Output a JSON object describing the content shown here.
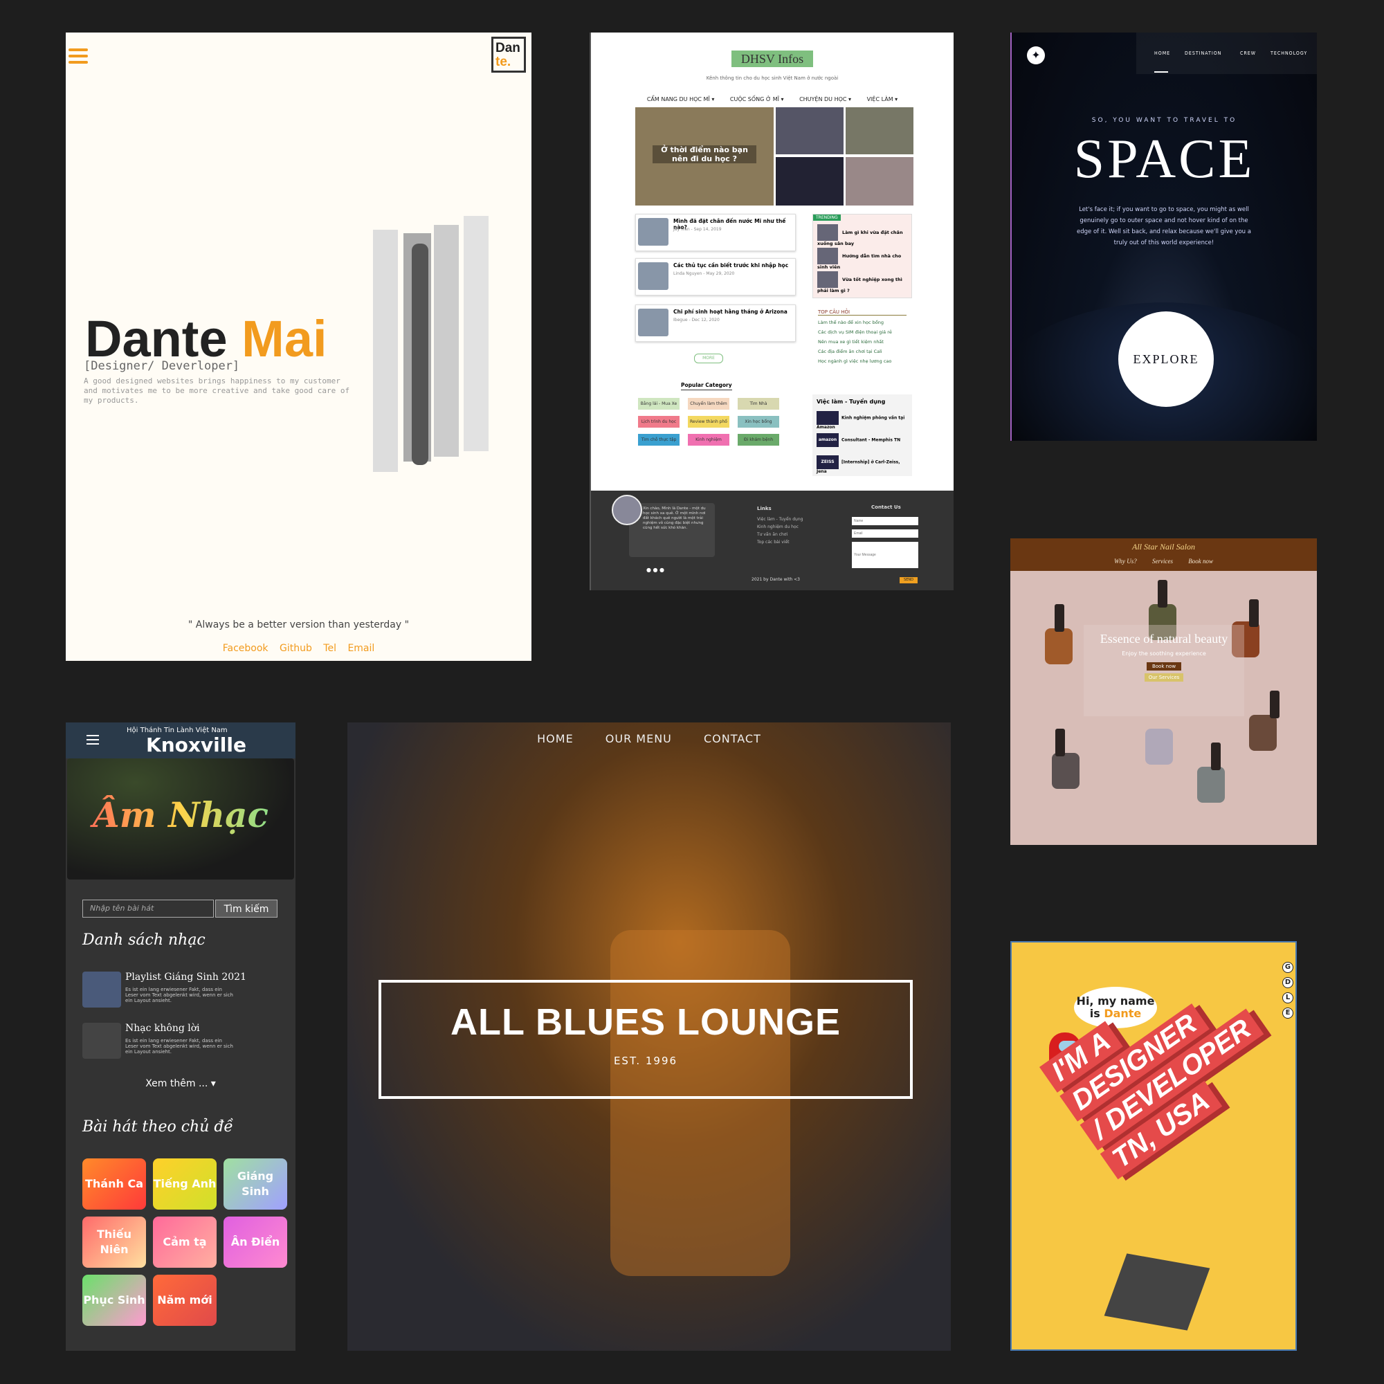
{
  "portfolio": {
    "logo_line1": "Dan",
    "logo_line2": "te.",
    "first_name": "Dante",
    "last_name": "Mai",
    "role": "[Designer/ Deverloper]",
    "description": "A good designed websites brings happiness to my customer and motivates me to be more creative and take good care of my products.",
    "quote": "\" Always be a better version than yesterday \"",
    "links": [
      "Facebook",
      "Github",
      "Tel",
      "Email"
    ]
  },
  "dhsv": {
    "title": "DHSV Infos",
    "tagline": "Kênh thông tin cho du học sinh Việt Nam ở nước ngoài",
    "nav": [
      "CẨM NANG DU HỌC MĨ ▾",
      "CUỘC SỐNG Ở MĨ ▾",
      "CHUYỆN DU HỌC ▾",
      "VIỆC LÀM ▾"
    ],
    "hero_title": "Ở thời điểm nào bạn nên đi du học ?",
    "posts": [
      {
        "title": "Mình đã đặt chân đến nước Mĩ như thế nào?",
        "meta": "Jay Tran - Sep 14, 2019"
      },
      {
        "title": "Các thủ tục cần biết trước khi nhập học",
        "meta": "Linda Nguyen - May 29, 2020"
      },
      {
        "title": "Chi phí sinh hoạt hằng tháng ở Arizona",
        "meta": "Ibegue - Dec 12, 2020"
      }
    ],
    "trending_label": "TRENDING",
    "trending": [
      "Làm gì khi vừa đặt chân xuống sân bay",
      "Hướng dẫn tìm nhà cho sinh viên",
      "Vừa tốt nghiệp xong thì phải làm gì ?"
    ],
    "more_label": "MORE",
    "faq_title": "TOP CÂU HỎI",
    "faq": [
      "Làm thế nào để xin học bổng",
      "Các dịch vụ SIM điện thoại giá rẻ",
      "Nên mua xe gì tiết kiệm nhất",
      "Các địa điểm ăn chơi tại Cali",
      "Học ngành gì việc nhẹ lương cao"
    ],
    "popular_category": "Popular Category",
    "categories": [
      "Bằng lái - Mua Xe",
      "Chuyến làm thêm",
      "Tìm Nhà",
      "Lịch trình du học",
      "Review thành phố",
      "Xin học bổng",
      "Tìm chỗ thực tập",
      "Kinh nghiệm",
      "Đi khám bệnh"
    ],
    "jobs_title": "Việc làm - Tuyển dụng",
    "jobs": [
      {
        "title": "Kinh nghiệm phỏng vấn tại Amazon",
        "logo": ""
      },
      {
        "title": "Consultant - Memphis TN",
        "logo": "amazon"
      },
      {
        "title": "[Internship] ở Carl-Zeiss, Jena",
        "logo": "ZEISS"
      }
    ],
    "footer": {
      "bio": "Xin chào, Mình là Dante - một du học sinh xa quê. Ở một mình nơi đất khách quê người là một trải nghiệm vô cùng đặc biệt nhưng cũng hết sức khó khăn.",
      "links_title": "Links",
      "links": [
        "Việc làm - Tuyển dụng",
        "Kinh nghiệm du học",
        "Tư vấn ăn chơi",
        "Top các bài viết"
      ],
      "contact_title": "Contact Us",
      "name_placeholder": "Name",
      "email_placeholder": "Email",
      "message_placeholder": "Your Message",
      "send_label": "SEND",
      "copyright": "2021 by Dante with <3"
    }
  },
  "space": {
    "nav": [
      "HOME",
      "DESTINATION",
      "CREW",
      "TECHNOLOGY"
    ],
    "subtitle": "SO, YOU WANT TO TRAVEL TO",
    "title": "SPACE",
    "paragraph": "Let's face it; if you want to go to space, you might as well genuinely go to outer space and not hover kind of on the edge of it. Well sit back, and relax because we'll give you a truly out of this world experience!",
    "button": "EXPLORE"
  },
  "salon": {
    "brand": "All Star Nail Salon",
    "nav": [
      "Why Us?",
      "Services",
      "Book now"
    ],
    "headline": "Essence of natural beauty",
    "subline": "Enjoy the soothing experience",
    "book_button": "Book now",
    "services_button": "Our Services"
  },
  "church": {
    "org": "Hội Thánh Tin Lành Việt Nam",
    "city": "Knoxville",
    "hero": "Âm Nhạc",
    "search_placeholder": "Nhập tên bài hát",
    "search_button": "Tìm kiếm",
    "list_title": "Danh sách nhạc",
    "playlists": [
      {
        "title": "Playlist  Giáng Sinh 2021",
        "desc": "Es ist ein lang erwiesener Fakt, dass ein Leser vom Text abgelenkt wird, wenn er sich ein Layout ansieht."
      },
      {
        "title": "Nhạc không lời",
        "desc": "Es ist ein lang erwiesener Fakt, dass ein Leser vom Text abgelenkt wird, wenn er sich ein Layout ansieht."
      }
    ],
    "see_more": "Xem thêm ... ▾",
    "topics_title": "Bài hát theo chủ đề",
    "topics": [
      "Thánh Ca",
      "Tiếng Anh",
      "Giáng Sinh",
      "Thiếu Niên",
      "Cảm tạ",
      "Ân Điển",
      "Phục Sinh",
      "Năm mới"
    ]
  },
  "lounge": {
    "nav": [
      "HOME",
      "OUR MENU",
      "CONTACT"
    ],
    "title": "ALL BLUES LOUNGE",
    "est": "EST. 1996"
  },
  "poster": {
    "greeting_line1": "Hi, my name",
    "greeting_line2": "is",
    "greeting_name": "Dante",
    "side_letters": [
      "G",
      "D",
      "L",
      "E"
    ],
    "lines": [
      "I'M A",
      "DESIGNER",
      "/ DEVELOPER",
      "TN, USA"
    ]
  }
}
